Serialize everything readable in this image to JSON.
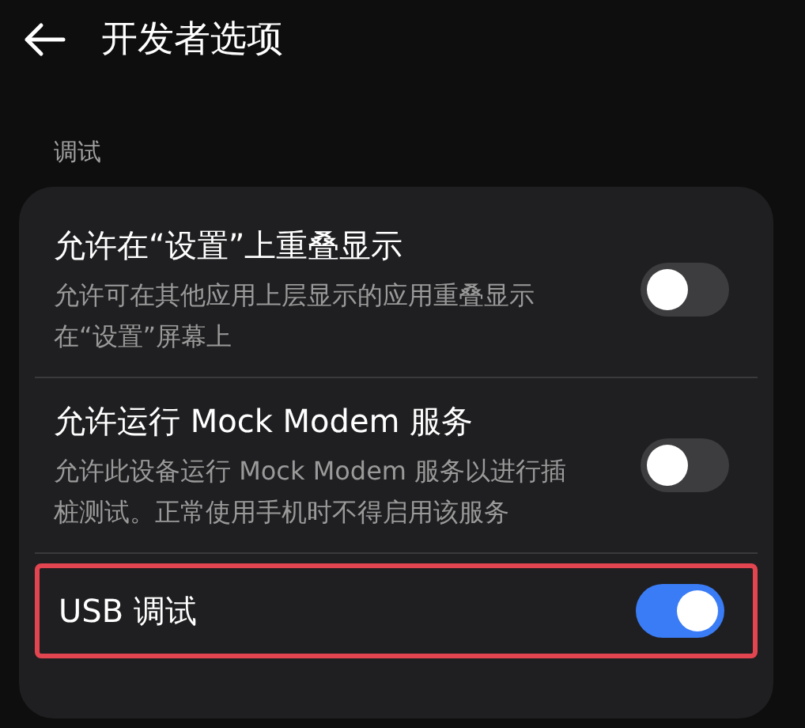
{
  "header": {
    "title": "开发者选项"
  },
  "section": {
    "label": "调试"
  },
  "settings": [
    {
      "title": "允许在“设置”上重叠显示",
      "description": "允许可在其他应用上层显示的应用重叠显示在“设置”屏幕上",
      "on": false,
      "highlighted": false
    },
    {
      "title": "允许运行 Mock Modem 服务",
      "description": "允许此设备运行 Mock Modem 服务以进行插桩测试。正常使用手机时不得启用该服务",
      "on": false,
      "highlighted": false
    },
    {
      "title": "USB 调试",
      "on": true,
      "highlighted": true
    }
  ]
}
